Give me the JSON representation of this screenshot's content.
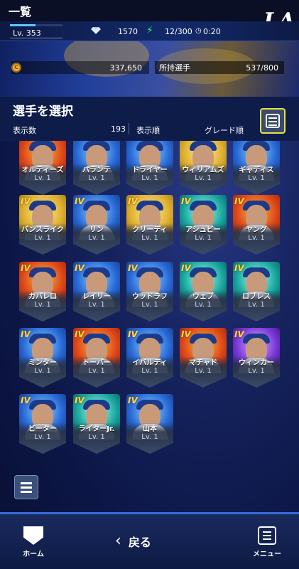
{
  "header": {
    "title": "一覧",
    "team_logo": "LA"
  },
  "status": {
    "level": "Lv. 353",
    "gems": "1570",
    "stamina": "12/300",
    "stamina_timer": "0:20"
  },
  "resources": {
    "coins": "337,650",
    "owned_label": "所持選手",
    "owned_value": "537/800"
  },
  "selection": {
    "title": "選手を選択",
    "count_label": "表示数",
    "count_value": "193",
    "sort_label": "表示順",
    "sort_value": "グレード順"
  },
  "players": [
    {
      "name": "オルティーズ",
      "lv": "Lv. 1",
      "grade": "",
      "bg": "g-red"
    },
    {
      "name": "パランテ",
      "lv": "Lv. 1",
      "grade": "",
      "bg": "g-blue"
    },
    {
      "name": "ドライヤー",
      "lv": "Lv. 1",
      "grade": "",
      "bg": "g-blue"
    },
    {
      "name": "ウィリアムズ",
      "lv": "Lv. 1",
      "grade": "",
      "bg": "g-gold"
    },
    {
      "name": "ギャディス",
      "lv": "Lv. 1",
      "grade": "",
      "bg": "g-blue"
    },
    {
      "name": "バンスライク",
      "lv": "Lv. 1",
      "grade": "IV",
      "bg": "g-gold"
    },
    {
      "name": "リン",
      "lv": "Lv. 1",
      "grade": "IV",
      "bg": "g-blue"
    },
    {
      "name": "クリーディ",
      "lv": "Lv. 1",
      "grade": "IV",
      "bg": "g-gold"
    },
    {
      "name": "アシュビー",
      "lv": "Lv. 1",
      "grade": "IV",
      "bg": "g-teal"
    },
    {
      "name": "ヤング",
      "lv": "Lv. 1",
      "grade": "IV",
      "bg": "g-red"
    },
    {
      "name": "カバレロ",
      "lv": "Lv. 1",
      "grade": "IV",
      "bg": "g-red"
    },
    {
      "name": "レイリー",
      "lv": "Lv. 1",
      "grade": "IV",
      "bg": "g-blue"
    },
    {
      "name": "ウッドラフ",
      "lv": "Lv. 1",
      "grade": "IV",
      "bg": "g-blue"
    },
    {
      "name": "ウェブ",
      "lv": "Lv. 1",
      "grade": "IV",
      "bg": "g-teal"
    },
    {
      "name": "ロブレス",
      "lv": "Lv. 1",
      "grade": "IV",
      "bg": "g-teal"
    },
    {
      "name": "ミンター",
      "lv": "Lv. 1",
      "grade": "IV",
      "bg": "g-blue"
    },
    {
      "name": "トーバー",
      "lv": "Lv. 1",
      "grade": "IV",
      "bg": "g-red"
    },
    {
      "name": "イバルディ",
      "lv": "Lv. 1",
      "grade": "IV",
      "bg": "g-blue"
    },
    {
      "name": "マチャド",
      "lv": "Lv. 1",
      "grade": "IV",
      "bg": "g-red"
    },
    {
      "name": "ウィンカー",
      "lv": "Lv. 1",
      "grade": "IV",
      "bg": "g-purple"
    },
    {
      "name": "ビーター",
      "lv": "Lv. 1",
      "grade": "IV",
      "bg": "g-blue"
    },
    {
      "name": "ライターJr.",
      "lv": "Lv. 1",
      "grade": "IV",
      "bg": "g-teal"
    },
    {
      "name": "山本",
      "lv": "Lv. 1",
      "grade": "IV",
      "bg": "g-blue"
    }
  ],
  "nav": {
    "home": "ホーム",
    "back": "戻る",
    "menu": "メニュー"
  }
}
